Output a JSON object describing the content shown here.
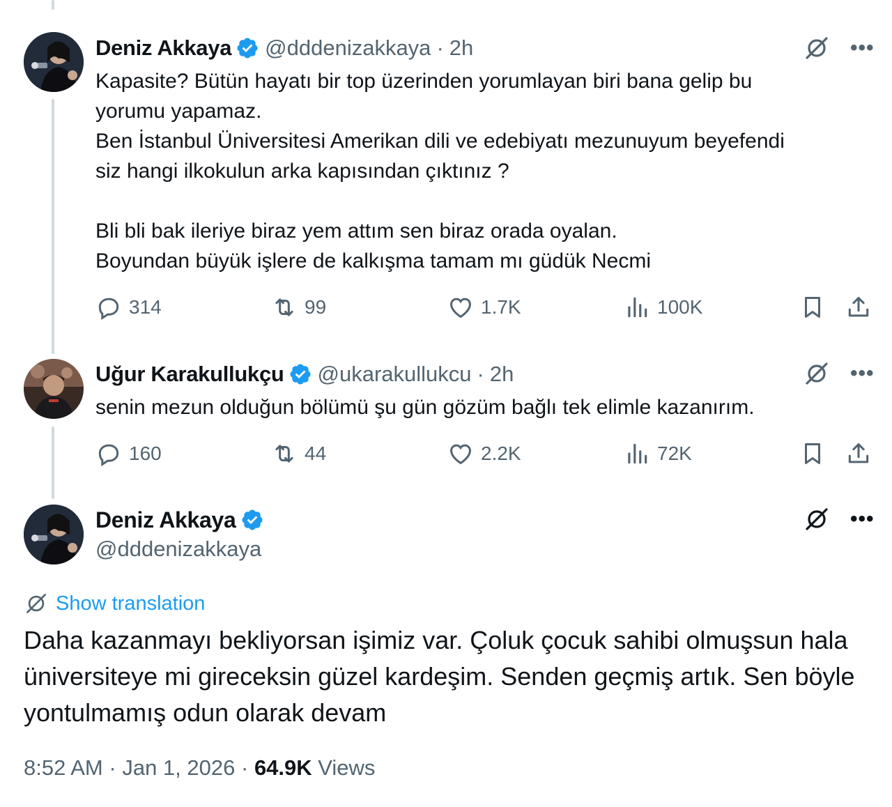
{
  "tweets": [
    {
      "name": "Deniz Akkaya",
      "handle": "@dddenizakkaya",
      "separator": "·",
      "time": "2h",
      "text": "Kapasite? Bütün hayatı bir top üzerinden yorumlayan biri bana gelip bu\nyorumu yapamaz.\nBen İstanbul Üniversitesi Amerikan dili ve edebiyatı mezunuyum beyefendi\nsiz hangi ilkokulun arka kapısından çıktınız ?\n\nBli bli bak ileriye biraz yem attım sen biraz orada oyalan.\nBoyundan büyük işlere de kalkışma tamam mı güdük Necmi",
      "replies": "314",
      "reposts": "99",
      "likes": "1.7K",
      "views": "100K"
    },
    {
      "name": "Uğur Karakullukçu",
      "handle": "@ukarakullukcu",
      "separator": "·",
      "time": "2h",
      "text": "senin mezun olduğun bölümü şu gün gözüm bağlı tek elimle kazanırım.",
      "replies": "160",
      "reposts": "44",
      "likes": "2.2K",
      "views": "72K"
    }
  ],
  "main_tweet": {
    "name": "Deniz Akkaya",
    "handle": "@dddenizakkaya",
    "show_translation": "Show translation",
    "text": "Daha kazanmayı bekliyorsan işimiz var. Çoluk çocuk sahibi olmuşsun hala üniversiteye mi gireceksin güzel kardeşim. Senden geçmiş artık. Sen böyle yontulmamış odun olarak devam",
    "time": "8:52 AM",
    "separator": "·",
    "date": "Jan 1, 2026",
    "views_count": "64.9K",
    "views_label": "Views"
  },
  "icons": {
    "verified": "verified-badge-icon",
    "grok": "grok-icon",
    "more": "more-icon",
    "reply": "reply-icon",
    "repost": "repost-icon",
    "like": "like-icon",
    "views": "views-icon",
    "bookmark": "bookmark-icon",
    "share": "share-icon",
    "translate": "translate-icon"
  },
  "colors": {
    "text": "#0f1419",
    "secondary": "#536471",
    "accent": "#1d9bf0",
    "thread_line": "#cfd9de"
  }
}
